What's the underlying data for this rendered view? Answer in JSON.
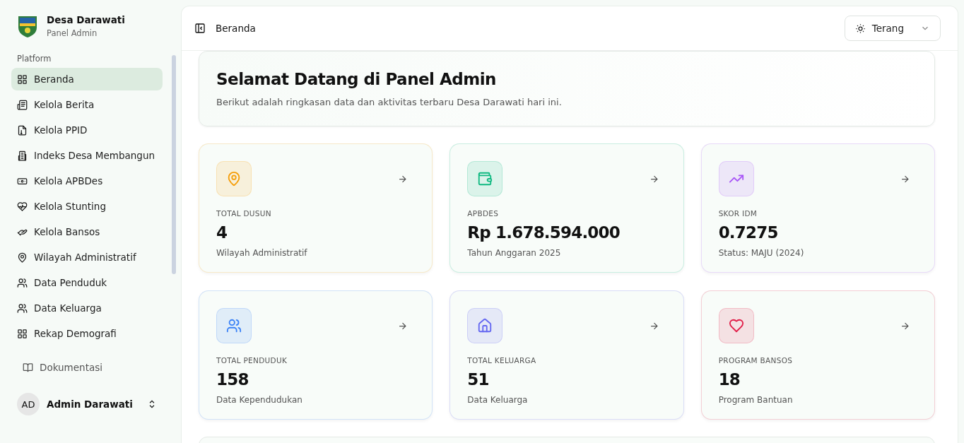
{
  "brand": {
    "name": "Desa Darawati",
    "subtitle": "Panel Admin"
  },
  "sidebar": {
    "group_label": "Platform",
    "items": [
      {
        "label": "Beranda",
        "kind": "grid",
        "selected": true
      },
      {
        "label": "Kelola Berita",
        "kind": "news",
        "selected": false
      },
      {
        "label": "Kelola PPID",
        "kind": "file",
        "selected": false
      },
      {
        "label": "Indeks Desa Membangun",
        "kind": "building",
        "selected": false
      },
      {
        "label": "Kelola APBDes",
        "kind": "money",
        "selected": false
      },
      {
        "label": "Kelola Stunting",
        "kind": "heartpulse",
        "selected": false
      },
      {
        "label": "Kelola Bansos",
        "kind": "hand",
        "selected": false
      },
      {
        "label": "Wilayah Administratif",
        "kind": "pin",
        "selected": false
      },
      {
        "label": "Data Penduduk",
        "kind": "users",
        "selected": false
      },
      {
        "label": "Data Keluarga",
        "kind": "users",
        "selected": false
      },
      {
        "label": "Rekap Demografi",
        "kind": "grid",
        "selected": false
      }
    ],
    "footer_link": "Dokumentasi",
    "user": {
      "initials": "AD",
      "name": "Admin Darawati"
    }
  },
  "header": {
    "breadcrumb": "Beranda",
    "theme_select": "Terang"
  },
  "welcome": {
    "title": "Selamat Datang di Panel Admin",
    "text": "Berikut adalah ringkasan data dan aktivitas terbaru Desa Darawati hari ini."
  },
  "stats": [
    {
      "label": "TOTAL DUSUN",
      "value": "4",
      "caption": "Wilayah Administratif",
      "kind": "pin",
      "color": "#f59e0b"
    },
    {
      "label": "APBDES",
      "value": "Rp 1.678.594.000",
      "caption": "Tahun Anggaran 2025",
      "kind": "wallet",
      "color": "#10b981"
    },
    {
      "label": "SKOR IDM",
      "value": "0.7275",
      "caption": "Status: MAJU (2024)",
      "kind": "trend",
      "color": "#a855f7"
    },
    {
      "label": "TOTAL PENDUDUK",
      "value": "158",
      "caption": "Data Kependudukan",
      "kind": "users",
      "color": "#3b82f6"
    },
    {
      "label": "TOTAL KELUARGA",
      "value": "51",
      "caption": "Data Keluarga",
      "kind": "home",
      "color": "#6366f1"
    },
    {
      "label": "PROGRAM BANSOS",
      "value": "18",
      "caption": "Program Bantuan",
      "kind": "heart",
      "color": "#e11d48"
    }
  ]
}
